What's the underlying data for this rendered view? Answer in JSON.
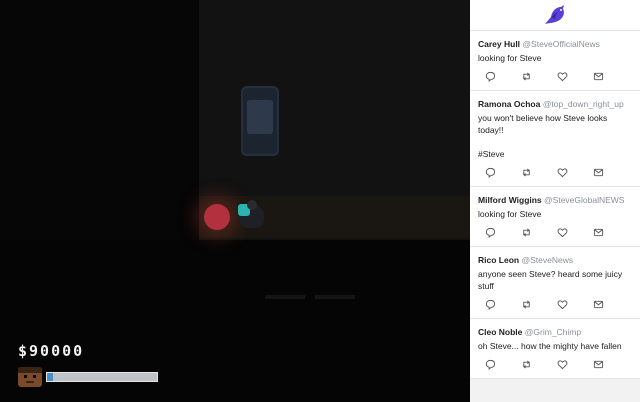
{
  "hud": {
    "money": "$90000",
    "progress_fraction": 0.05,
    "icons": {
      "avatar": "player-face-icon"
    }
  },
  "feed": {
    "logo_icon": "bird-icon",
    "accent_color": "#5c3fd9",
    "tweets": [
      {
        "name": "Carey Hull",
        "handle": "@SteveOfficialNews",
        "text": "looking for Steve"
      },
      {
        "name": "Ramona Ochoa",
        "handle": "@top_down_right_up",
        "text": "you won't believe how Steve looks today!!\n\n#Steve"
      },
      {
        "name": "Milford Wiggins",
        "handle": "@SteveGlobalNEWS",
        "text": "looking for Steve"
      },
      {
        "name": "Rico Leon",
        "handle": "@SteveNews",
        "text": "anyone seen Steve? heard some juicy stuff"
      },
      {
        "name": "Cleo Noble",
        "handle": "@Grim_Chimp",
        "text": "oh Steve... how the mighty have fallen"
      }
    ],
    "action_icons": [
      "reply-icon",
      "retweet-icon",
      "like-icon",
      "message-icon"
    ]
  }
}
